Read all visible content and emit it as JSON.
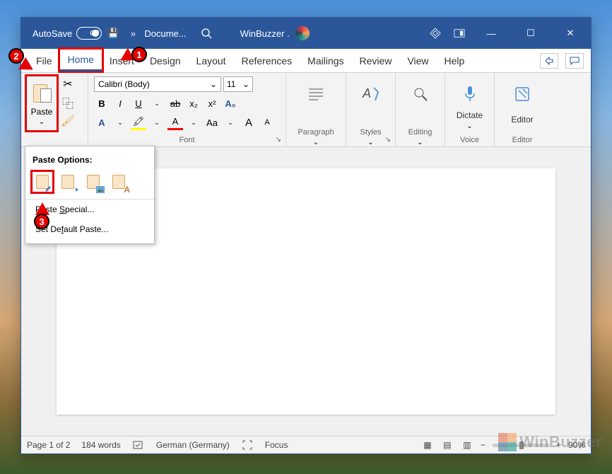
{
  "titlebar": {
    "autosave_label": "AutoSave",
    "toggle_state": "Off",
    "doc_name": "Docume...",
    "app_label": "WinBuzzer .",
    "minimize": "—",
    "maximize": "☐",
    "close": "✕"
  },
  "tabs": {
    "file": "File",
    "home": "Home",
    "insert": "Insert",
    "design": "Design",
    "layout": "Layout",
    "references": "References",
    "mailings": "Mailings",
    "review": "Review",
    "view": "View",
    "help": "Help"
  },
  "clipboard": {
    "paste": "Paste"
  },
  "font": {
    "name": "Calibri (Body)",
    "size": "11",
    "bold": "B",
    "italic": "I",
    "underline": "U",
    "strike": "ab",
    "subscript": "x₂",
    "superscript": "x²",
    "casechange": "Aa",
    "grow": "A",
    "shrink": "A",
    "group_label": "Font"
  },
  "groups": {
    "paragraph": "Paragraph",
    "styles": "Styles",
    "editing": "Editing",
    "voice": "Voice",
    "dictate": "Dictate",
    "editor": "Editor"
  },
  "paste_menu": {
    "header": "Paste Options:",
    "special_pre": "Paste ",
    "special_u": "S",
    "special_post": "pecial...",
    "default_pre": "Set De",
    "default_u": "f",
    "default_post": "ault Paste..."
  },
  "statusbar": {
    "page": "Page 1 of 2",
    "words": "184 words",
    "language": "German (Germany)",
    "focus": "Focus",
    "zoom": "90%"
  },
  "callouts": {
    "c1": "1",
    "c2": "2",
    "c3": "3"
  },
  "watermark": "WinBuzzer"
}
